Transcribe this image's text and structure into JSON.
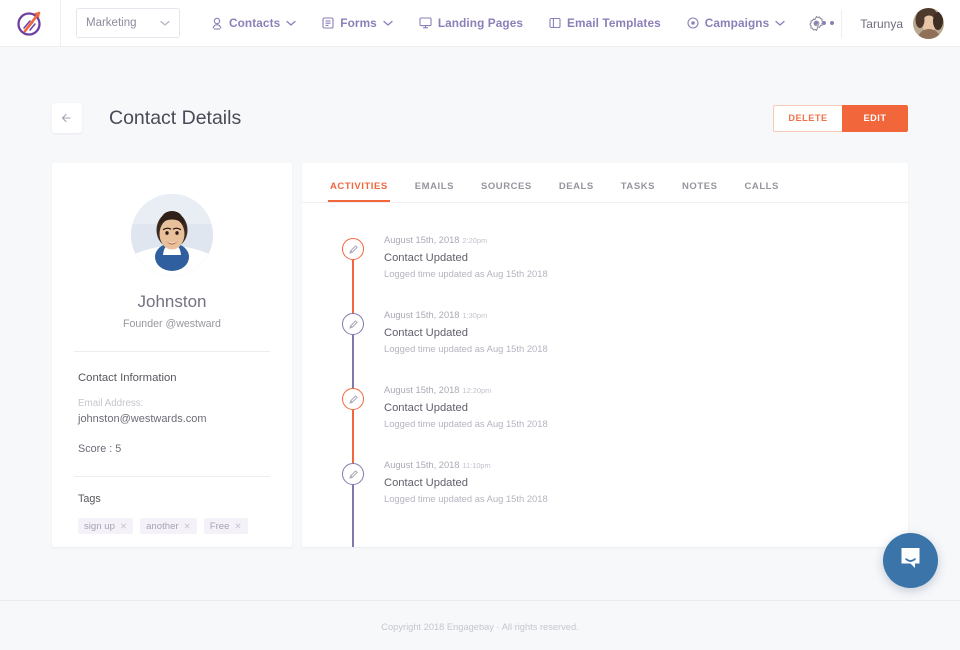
{
  "navbar": {
    "logo_icon": "engagebay-logo-icon",
    "workspace": {
      "label": "Marketing",
      "chevron_icon": "chevron-down-icon"
    },
    "items": [
      {
        "label": "Contacts",
        "icon": "contact-person-icon",
        "has_chevron": true
      },
      {
        "label": "Forms",
        "icon": "form-document-icon",
        "has_chevron": true
      },
      {
        "label": "Landing Pages",
        "icon": "monitor-icon",
        "has_chevron": false
      },
      {
        "label": "Email Templates",
        "icon": "columns-template-icon",
        "has_chevron": false
      },
      {
        "label": "Campaigns",
        "icon": "target-circle-icon",
        "has_chevron": true
      }
    ],
    "more_icon": "more-horizontal-icon",
    "settings_icon": "gear-icon",
    "user": {
      "name": "Tarunya",
      "avatar_icon": "user-avatar"
    }
  },
  "header": {
    "back_icon": "arrow-left-icon",
    "title": "Contact Details",
    "delete_label": "DELETE",
    "edit_label": "EDIT"
  },
  "contact": {
    "photo_icon": "contact-photo",
    "name": "Johnston",
    "role": "Founder @westward",
    "section_title": "Contact Information",
    "email_label": "Email Address:",
    "email_value": "johnston@westwards.com",
    "score": "Score : 5",
    "tags_title": "Tags",
    "tags": [
      {
        "label": "sign up",
        "remove_icon": "close-icon"
      },
      {
        "label": "another",
        "remove_icon": "close-icon"
      },
      {
        "label": "Free",
        "remove_icon": "close-icon"
      }
    ]
  },
  "tabs": [
    {
      "label": "ACTIVITIES",
      "active": true
    },
    {
      "label": "EMAILS",
      "active": false
    },
    {
      "label": "SOURCES",
      "active": false
    },
    {
      "label": "DEALS",
      "active": false
    },
    {
      "label": "TASKS",
      "active": false
    },
    {
      "label": "NOTES",
      "active": false
    },
    {
      "label": "CALLS",
      "active": false
    }
  ],
  "timeline": [
    {
      "date": "August 15th, 2018",
      "time": "2:20pm",
      "title": "Contact Updated",
      "description": "Logged time updated as Aug 15th 2018",
      "icon": "pencil-edit-icon",
      "color": "#f2663c"
    },
    {
      "date": "August 15th, 2018",
      "time": "1:30pm",
      "title": "Contact Updated",
      "description": "Logged time updated as Aug 15th 2018",
      "icon": "pencil-edit-icon",
      "color": "#8179ad"
    },
    {
      "date": "August 15th, 2018",
      "time": "12:20pm",
      "title": "Contact Updated",
      "description": "Logged time updated as Aug 15th 2018",
      "icon": "pencil-edit-icon",
      "color": "#f2663c"
    },
    {
      "date": "August 15th, 2018",
      "time": "11:10pm",
      "title": "Contact Updated",
      "description": "Logged time updated as Aug 15th 2018",
      "icon": "pencil-edit-icon",
      "color": "#8179ad"
    }
  ],
  "footer": {
    "copyright": "Copyright 2018 Engagebay · All rights reserved."
  },
  "chat": {
    "icon": "chat-bubble-smile-icon"
  },
  "colors": {
    "accent_orange": "#f2663c",
    "nav_purple": "#8c7fb8",
    "timeline_purple": "#8179ad",
    "page_bg": "#f7f8fa",
    "chat_blue": "#3a74a8"
  }
}
